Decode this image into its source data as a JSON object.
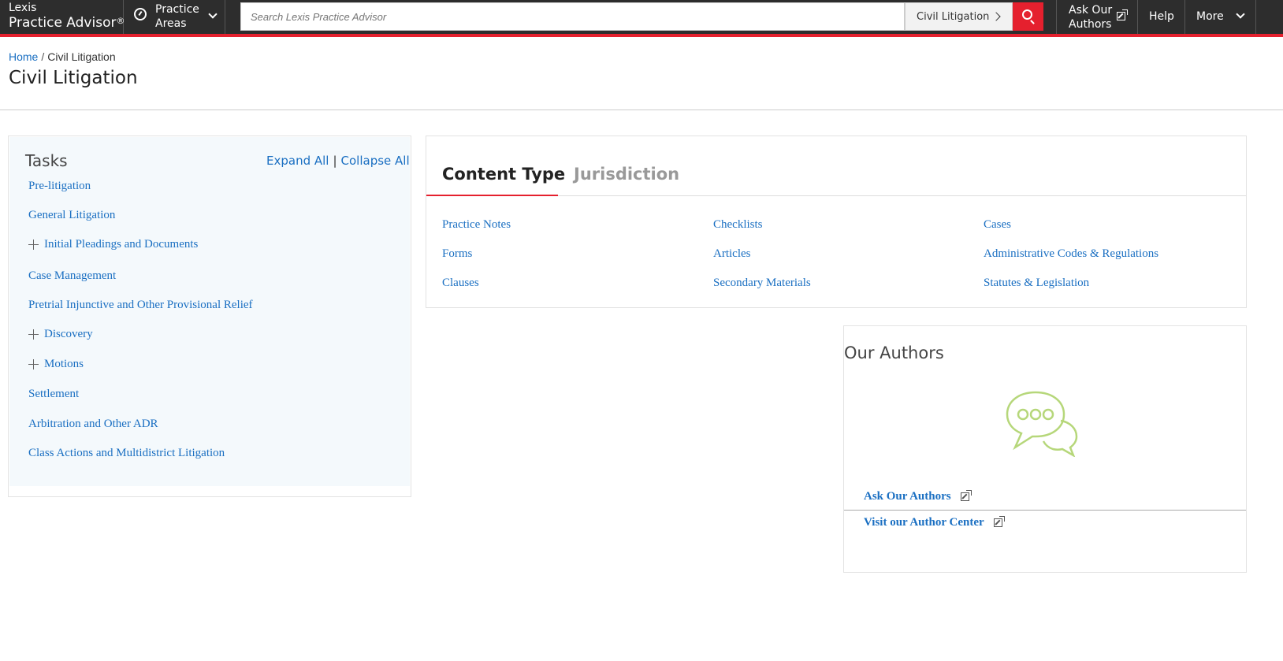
{
  "brand": {
    "line1": "Lexis",
    "line2": "Practice Advisor",
    "reg": "®"
  },
  "nav": {
    "practice_areas_line1": "Practice",
    "practice_areas_line2": "Areas",
    "search_placeholder": "Search Lexis Practice Advisor",
    "search_scope": "Civil Litigation",
    "ask_line1": "Ask Our",
    "ask_line2": "Authors",
    "help": "Help",
    "more": "More"
  },
  "breadcrumb": {
    "home": "Home",
    "sep": "/",
    "current": "Civil Litigation"
  },
  "page_title": "Civil Litigation",
  "tasks": {
    "title": "Tasks",
    "expand_all": "Expand All",
    "divider": "|",
    "collapse_all": "Collapse All",
    "items": [
      {
        "label": "Pre-litigation",
        "expandable": false
      },
      {
        "label": "General Litigation",
        "expandable": false
      },
      {
        "label": "Initial Pleadings and Documents",
        "expandable": true
      },
      {
        "label": "Case Management",
        "expandable": false
      },
      {
        "label": "Pretrial Injunctive and Other Provisional Relief",
        "expandable": false
      },
      {
        "label": "Discovery",
        "expandable": true
      },
      {
        "label": "Motions",
        "expandable": true
      },
      {
        "label": "Settlement",
        "expandable": false
      },
      {
        "label": "Arbitration and Other ADR",
        "expandable": false
      },
      {
        "label": "Class Actions and Multidistrict Litigation",
        "expandable": false
      }
    ]
  },
  "content_panel": {
    "tabs": [
      {
        "label": "Content Type",
        "active": true
      },
      {
        "label": "Jurisdiction",
        "active": false
      }
    ],
    "links": [
      [
        "Practice Notes",
        "Checklists",
        "Cases"
      ],
      [
        "Forms",
        "Articles",
        "Administrative Codes & Regulations"
      ],
      [
        "Clauses",
        "Secondary Materials",
        "Statutes & Legislation"
      ]
    ]
  },
  "authors": {
    "title": "Our Authors",
    "ask_link": "Ask Our Authors",
    "visit_link": "Visit our Author Center"
  },
  "colors": {
    "accent_red": "#e5202e",
    "link_blue": "#1a6fc2",
    "topbar": "#2d2d2d",
    "chat_icon_green": "#b6d77a"
  }
}
